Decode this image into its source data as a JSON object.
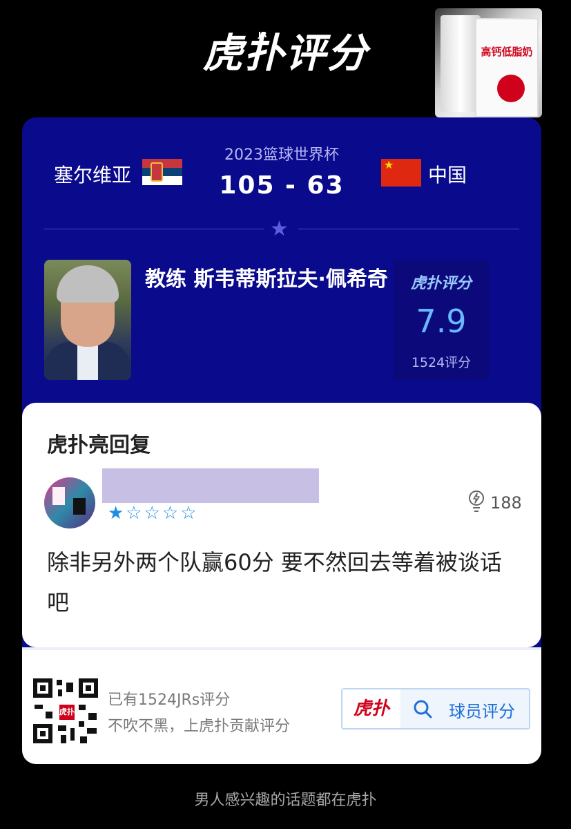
{
  "header": {
    "logo": "虎扑评分",
    "logo_superscript": "JR"
  },
  "ad": {
    "product_text": "高钙低脂奶"
  },
  "match": {
    "title": "2023篮球世界杯",
    "home_team": "塞尔维亚",
    "away_team": "中国",
    "score": "105 - 63",
    "home_flag": "serbia-flag",
    "away_flag": "china-flag"
  },
  "subject": {
    "name": "教练 斯韦蒂斯拉夫·佩希奇",
    "rating_logo": "虎扑评分",
    "rating": "7.9",
    "rating_count": "1524评分"
  },
  "reply": {
    "section_title": "虎扑亮回复",
    "stars_filled": 1,
    "stars_total": 5,
    "stars_text": "★☆☆☆☆",
    "light_count": "188",
    "text": "除非另外两个队赢60分 要不然回去等着被谈话吧"
  },
  "footer": {
    "line1": "已有1524JRs评分",
    "line2": "不吹不黑，上虎扑贡献评分",
    "brand": "虎扑",
    "search_label": "球员评分",
    "qr_center": "虎扑"
  },
  "bottom_slogan": "男人感兴趣的话题都在虎扑",
  "colors": {
    "card_bg": "#0a0a8c",
    "accent_blue": "#1d8fe0",
    "rating_blue": "#6ab8ff",
    "brand_red": "#d0021b"
  }
}
